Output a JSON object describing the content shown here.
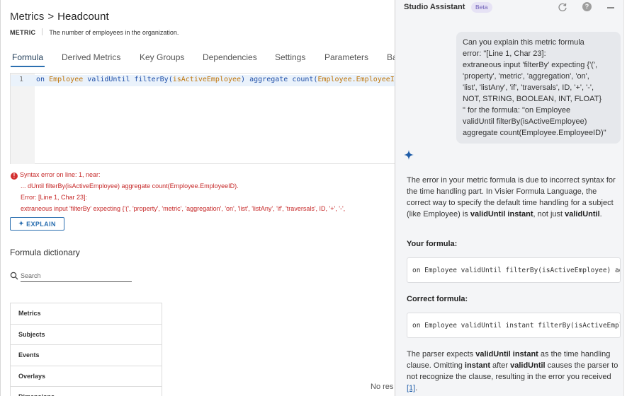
{
  "header": {
    "breadcrumb_parent": "Metrics",
    "breadcrumb_sep": ">",
    "breadcrumb_current": "Headcount",
    "metric_tag": "METRIC",
    "metric_description": "The number of employees in the organization."
  },
  "tabs": [
    {
      "label": "Formula",
      "active": true
    },
    {
      "label": "Derived Metrics"
    },
    {
      "label": "Key Groups"
    },
    {
      "label": "Dependencies"
    },
    {
      "label": "Settings"
    },
    {
      "label": "Parameters"
    },
    {
      "label": "Ba"
    }
  ],
  "editor": {
    "line_number": "1",
    "tokens": {
      "t1": "on",
      "t2": "Employee",
      "t3": "validUntil",
      "t4": "filterBy(",
      "t5": "isActiveEmployee",
      "t6": ")",
      "t7": "aggregate",
      "t8": "count(",
      "t9": "Employee.EmployeeID",
      "t10": ")"
    }
  },
  "error": {
    "icon": "!",
    "line1": "Syntax error on line: 1, near:",
    "line2": "... dUntil filterBy(isActiveEmployee) aggregate count(Employee.EmployeeID).",
    "line3": "Error: [Line 1, Char 23]:",
    "line4": "extraneous input 'filterBy' expecting {'(', 'property', 'metric', 'aggregation', 'on', 'list', 'listAny', 'if', 'traversals', ID, '+', '-',"
  },
  "explain_button": {
    "label": "EXPLAIN"
  },
  "dictionary": {
    "title": "Formula dictionary",
    "search_placeholder": "Search",
    "items": [
      "Metrics",
      "Subjects",
      "Events",
      "Overlays",
      "Dimensions"
    ],
    "no_results": "No res"
  },
  "assistant": {
    "title": "Studio Assistant",
    "beta": "Beta",
    "help_glyph": "?",
    "user_message": [
      "Can you explain this metric formula",
      "error: \"[Line 1, Char 23]:",
      "extraneous input 'filterBy' expecting {'(',",
      "'property', 'metric', 'aggregation', 'on',",
      "'list', 'listAny', 'if', 'traversals', ID, '+', '-',",
      "NOT, STRING, BOOLEAN, INT, FLOAT}",
      "\" for the formula: \"on Employee",
      "validUntil filterBy(isActiveEmployee)",
      "aggregate count(Employee.EmployeeID)\""
    ],
    "reply": {
      "p1a": "The error in your metric formula is due to incorrect syntax for the time handling part. In Visier Formula Language, the correct way to specify the default time handling for a subject (like Employee) is ",
      "p1b": "validUntil instant",
      "p1c": ", not just ",
      "p1d": "validUntil",
      "p1e": ".",
      "your_formula_label": "Your formula:",
      "your_formula": "on Employee validUntil filterBy(isActiveEmployee) aggregate count(Employee.EmployeeID)",
      "correct_formula_label": "Correct formula:",
      "correct_formula": "on Employee validUntil instant filterBy(isActiveEmployee) aggregate count(Employee.EmployeeID)",
      "p2a": "The parser expects ",
      "p2b": "validUntil instant",
      "p2c": " as the time handling clause. Omitting ",
      "p2d": "instant",
      "p2e": " after ",
      "p2f": "validUntil",
      "p2g": " causes the parser to not recognize the clause, resulting in the error you received ",
      "p2h": "[1]",
      "p2i": "."
    }
  }
}
